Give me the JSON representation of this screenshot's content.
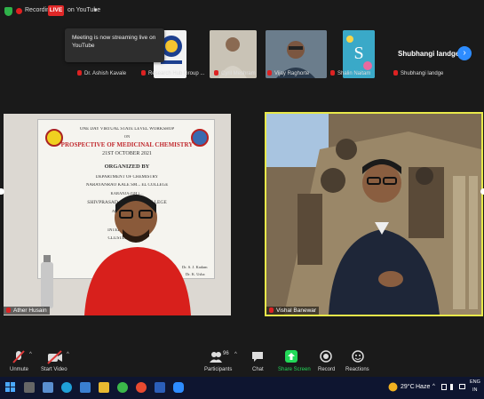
{
  "top_bar": {
    "recording_label": "Recording",
    "live_badge": "LIVE",
    "stream_label": "on YouTube",
    "stream_caret": "▾"
  },
  "tooltip": {
    "text": "Meeting is now streaming live on YouTube"
  },
  "thumbnails": [
    {
      "name": "Dr. Ashish Kavale"
    },
    {
      "name": "Research Hub Group ..."
    },
    {
      "name": "Cyril Meshram"
    },
    {
      "name": "Vijay Raghorte"
    },
    {
      "name": "Shalin Naitam"
    },
    {
      "name": "Shubhangi landge",
      "big_name": "Shubhangi landge"
    }
  ],
  "tiles": {
    "left_name": "Ather Husain",
    "right_name": "Vishal Banewar"
  },
  "banner": {
    "line1": "ONE DAY VIRTUAL STATE LEVEL WORKSHOP",
    "line2": "ON",
    "line3": "PROSPECTIVE OF MEDICINAL CHEMISTRY",
    "line4": "21ST OCTOBER 2021",
    "line5": "ORGANIZED BY",
    "line6": "DEPARTMENT OF CHEMISTRY",
    "line7": "NARAYANRAO KALE SM... EL COLLEGE",
    "line8": "KARANJA (GH.) ...",
    "line9": "SHIVPRASAD SADANA... COLLEGE",
    "line10": "ARJUNI/MORG...",
    "line11": "IN ASSOC...",
    "line12": "INTERNAL QUAL...",
    "line13": "CLUSTER OF THI...",
    "sig1": "Dr. S. J. Kadam",
    "sig2": "Dr. K. Usha"
  },
  "toolbar": {
    "unmute": "Unmute",
    "start_video": "Start Video",
    "participants_count": "96",
    "participants": "Participants",
    "chat": "Chat",
    "share_screen": "Share Screen",
    "record": "Record",
    "reactions": "Reactions"
  },
  "taskbar": {
    "temperature": "29°C",
    "weather": "Haze",
    "lang1": "ENG",
    "lang2": "IN"
  },
  "colors": {
    "accent_blue": "#2d8cff",
    "live_red": "#e02828",
    "share_green": "#23d959",
    "active_speaker": "#e8e84a"
  }
}
